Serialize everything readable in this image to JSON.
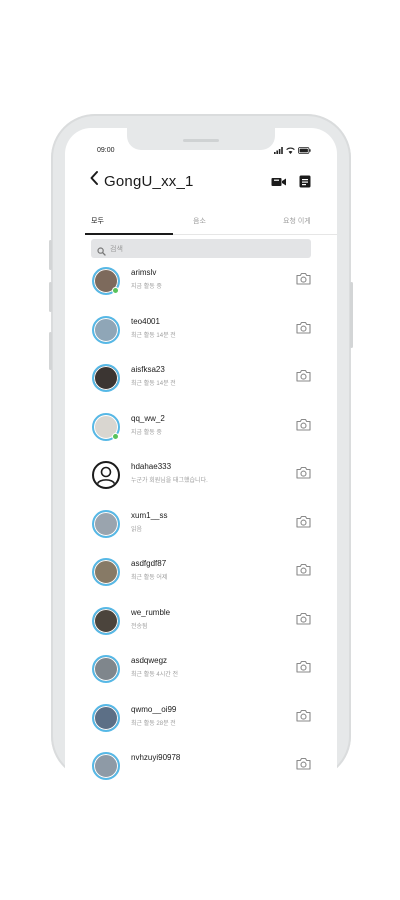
{
  "status_bar": {
    "time": "09:00"
  },
  "header": {
    "title": "GongU_xx_1",
    "back_icon": "chevron-left-icon",
    "video_icon": "video-camera-icon",
    "compose_icon": "compose-icon"
  },
  "tabs": [
    {
      "label": "모두",
      "active": true
    },
    {
      "label": "음소",
      "active": false
    },
    {
      "label": "요청 이게",
      "active": false
    }
  ],
  "search": {
    "placeholder": "검색"
  },
  "colors": {
    "ring": "#56b8e6",
    "online": "#58c25c",
    "screen_bezel": "#e6e8e9"
  },
  "conversations": [
    {
      "username": "arimslv",
      "status": "지금 활동 중",
      "online": true,
      "avatar": "#7d6a5c"
    },
    {
      "username": "teo4001",
      "status": "최근 활동 14분 전",
      "online": false,
      "avatar": "#8fa6b7"
    },
    {
      "username": "aisfksa23",
      "status": "최근 활동 14분 전",
      "online": false,
      "avatar": "#3b3532"
    },
    {
      "username": "qq_ww_2",
      "status": "지금 활동 중",
      "online": true,
      "avatar": "#d9d6d0"
    },
    {
      "username": "hdahae333",
      "status": "누군가 회원님을 태그했습니다.",
      "online": false,
      "avatar": "#ffffff"
    },
    {
      "username": "xum1__ss",
      "status": "읽음",
      "online": false,
      "avatar": "#9aa4ae"
    },
    {
      "username": "asdfgdf87",
      "status": "최근 활동 어제",
      "online": false,
      "avatar": "#877a66"
    },
    {
      "username": "we_rumble",
      "status": "전송됨",
      "online": false,
      "avatar": "#4b443c"
    },
    {
      "username": "asdqwegz",
      "status": "최근 활동 4시간 전",
      "online": false,
      "avatar": "#7f868c"
    },
    {
      "username": "qwmo__oi99",
      "status": "최근 활동 28분 전",
      "online": false,
      "avatar": "#5c6f86"
    },
    {
      "username": "nvhzuyi90978",
      "status": "",
      "online": false,
      "avatar": "#8e9aa6"
    }
  ]
}
